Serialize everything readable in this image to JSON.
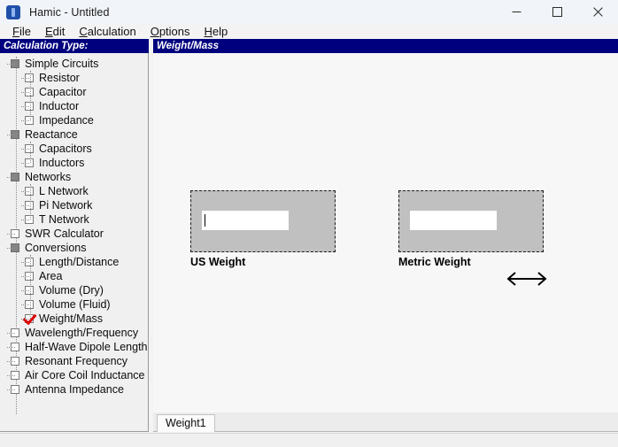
{
  "window": {
    "title": "Hamic - Untitled",
    "icon": "app-icon",
    "controls": {
      "minimize": "minimize-icon",
      "maximize": "maximize-icon",
      "close": "close-icon"
    }
  },
  "menubar": {
    "items": [
      {
        "label": "File",
        "accesskey": "F"
      },
      {
        "label": "Edit",
        "accesskey": "E"
      },
      {
        "label": "Calculation",
        "accesskey": "C"
      },
      {
        "label": "Options",
        "accesskey": "O"
      },
      {
        "label": "Help",
        "accesskey": "H"
      }
    ]
  },
  "captions": {
    "left": "Calculation Type:",
    "right": "Weight/Mass",
    "color": "#00007e"
  },
  "sidebar": {
    "items": [
      {
        "label": "Simple Circuits",
        "level": 1,
        "type": "parent",
        "checked": false
      },
      {
        "label": "Resistor",
        "level": 2,
        "type": "leaf",
        "checked": false
      },
      {
        "label": "Capacitor",
        "level": 2,
        "type": "leaf",
        "checked": false
      },
      {
        "label": "Inductor",
        "level": 2,
        "type": "leaf",
        "checked": false
      },
      {
        "label": "Impedance",
        "level": 2,
        "type": "leaf",
        "checked": false
      },
      {
        "label": "Reactance",
        "level": 1,
        "type": "parent",
        "checked": false
      },
      {
        "label": "Capacitors",
        "level": 2,
        "type": "leaf",
        "checked": false
      },
      {
        "label": "Inductors",
        "level": 2,
        "type": "leaf",
        "checked": false
      },
      {
        "label": "Networks",
        "level": 1,
        "type": "parent",
        "checked": false
      },
      {
        "label": "L Network",
        "level": 2,
        "type": "leaf",
        "checked": false
      },
      {
        "label": "Pi Network",
        "level": 2,
        "type": "leaf",
        "checked": false
      },
      {
        "label": "T Network",
        "level": 2,
        "type": "leaf",
        "checked": false
      },
      {
        "label": "SWR Calculator",
        "level": 1,
        "type": "leaf",
        "checked": false
      },
      {
        "label": "Conversions",
        "level": 1,
        "type": "parent",
        "checked": false
      },
      {
        "label": "Length/Distance",
        "level": 2,
        "type": "leaf",
        "checked": false
      },
      {
        "label": "Area",
        "level": 2,
        "type": "leaf",
        "checked": false
      },
      {
        "label": "Volume (Dry)",
        "level": 2,
        "type": "leaf",
        "checked": false
      },
      {
        "label": "Volume (Fluid)",
        "level": 2,
        "type": "leaf",
        "checked": false
      },
      {
        "label": "Weight/Mass",
        "level": 2,
        "type": "leaf",
        "checked": true
      },
      {
        "label": "Wavelength/Frequency",
        "level": 1,
        "type": "leaf",
        "checked": false
      },
      {
        "label": "Half-Wave Dipole Length",
        "level": 1,
        "type": "leaf",
        "checked": false
      },
      {
        "label": "Resonant Frequency",
        "level": 1,
        "type": "leaf",
        "checked": false
      },
      {
        "label": "Air Core Coil Inductance",
        "level": 1,
        "type": "leaf",
        "checked": false
      },
      {
        "label": "Antenna Impedance",
        "level": 1,
        "type": "leaf",
        "checked": false
      }
    ],
    "check_color": "#dd0000"
  },
  "main": {
    "converter": {
      "from": {
        "label": "US Weight",
        "value": "",
        "focused": true
      },
      "to": {
        "label": "Metric Weight",
        "value": "",
        "focused": false
      },
      "arrow": "double-arrow-icon"
    }
  },
  "tabs": {
    "items": [
      {
        "label": "Weight1",
        "active": true
      }
    ]
  }
}
